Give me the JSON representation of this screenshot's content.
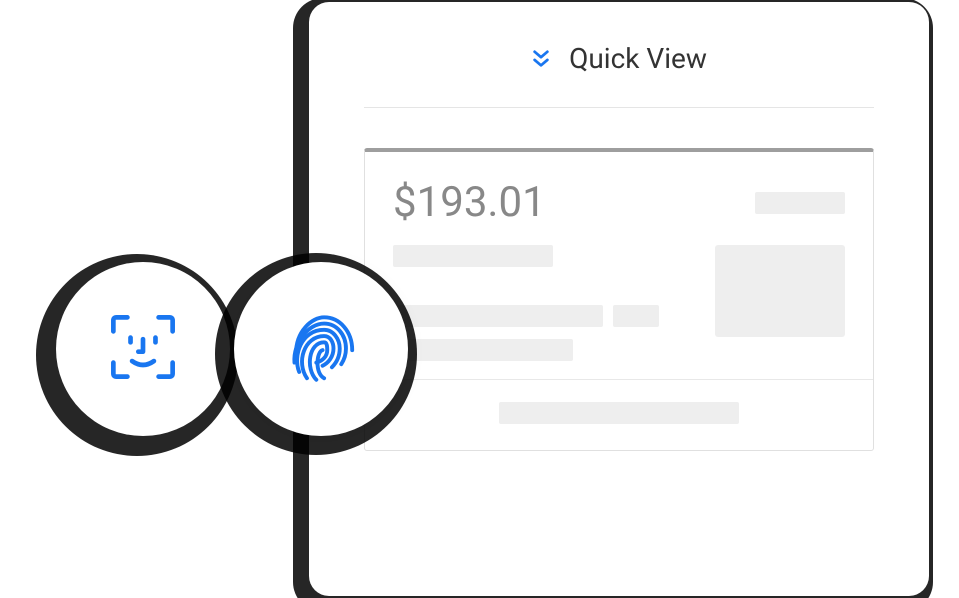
{
  "header": {
    "title": "Quick View"
  },
  "preview": {
    "amount": "$193.01"
  }
}
